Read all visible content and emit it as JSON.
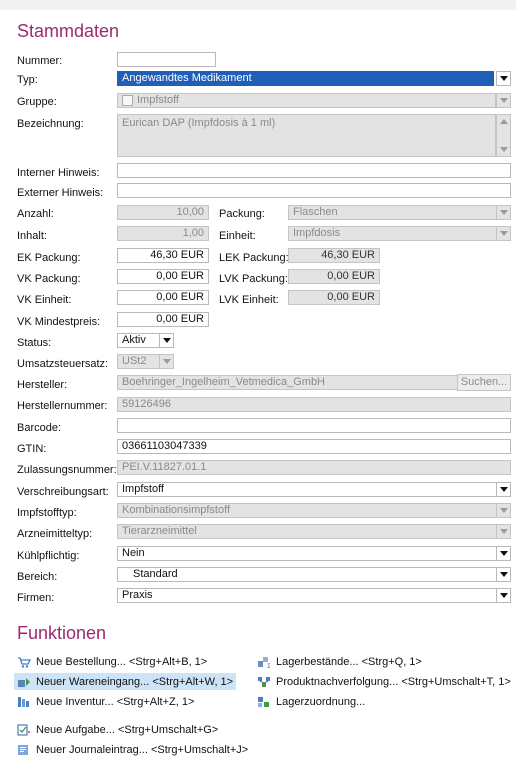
{
  "stammdaten": {
    "title": "Stammdaten",
    "nummer": {
      "label": "Nummer:",
      "value": ""
    },
    "typ": {
      "label": "Typ:",
      "value": "Angewandtes Medikament"
    },
    "gruppe": {
      "label": "Gruppe:",
      "value": "Impfstoff"
    },
    "bezeichnung": {
      "label": "Bezeichnung:",
      "value": "Eurican DAP (Impfdosis à 1 ml)"
    },
    "interner_hinweis": {
      "label": "Interner Hinweis:",
      "value": ""
    },
    "externer_hinweis": {
      "label": "Externer Hinweis:",
      "value": ""
    },
    "anzahl": {
      "label": "Anzahl:",
      "value": "10,00"
    },
    "packung": {
      "label": "Packung:",
      "value": "Flaschen"
    },
    "inhalt": {
      "label": "Inhalt:",
      "value": "1,00"
    },
    "einheit": {
      "label": "Einheit:",
      "value": "Impfdosis"
    },
    "ek_packung": {
      "label": "EK Packung:",
      "value": "46,30 EUR"
    },
    "lek_packung": {
      "label": "LEK Packung:",
      "value": "46,30 EUR"
    },
    "vk_packung": {
      "label": "VK Packung:",
      "value": "0,00 EUR"
    },
    "lvk_packung": {
      "label": "LVK Packung:",
      "value": "0,00 EUR"
    },
    "vk_einheit": {
      "label": "VK Einheit:",
      "value": "0,00 EUR"
    },
    "lvk_einheit": {
      "label": "LVK Einheit:",
      "value": "0,00 EUR"
    },
    "vk_mindestpreis": {
      "label": "VK Mindestpreis:",
      "value": "0,00 EUR"
    },
    "status": {
      "label": "Status:",
      "value": "Aktiv"
    },
    "umsatzsteuersatz": {
      "label": "Umsatzsteuersatz:",
      "value": "USt2"
    },
    "hersteller": {
      "label": "Hersteller:",
      "value": "Boehringer_Ingelheim_Vetmedica_GmbH",
      "button": "Suchen..."
    },
    "herstellernummer": {
      "label": "Herstellernummer:",
      "value": "59126496"
    },
    "barcode": {
      "label": "Barcode:",
      "value": ""
    },
    "gtin": {
      "label": "GTIN:",
      "value": "03661103047339"
    },
    "zulassungsnummer": {
      "label": "Zulassungsnummer:",
      "value": "PEI.V.11827.01.1"
    },
    "verschreibungsart": {
      "label": "Verschreibungsart:",
      "value": "Impfstoff"
    },
    "impfstofftyp": {
      "label": "Impfstofftyp:",
      "value": "Kombinationsimpfstoff"
    },
    "arzneimitteltyp": {
      "label": "Arzneimitteltyp:",
      "value": "Tierarzneimittel"
    },
    "kuehlpflichtig": {
      "label": "Kühlpflichtig:",
      "value": "Nein"
    },
    "bereich": {
      "label": "Bereich:",
      "value": "Standard"
    },
    "firmen": {
      "label": "Firmen:",
      "value": "Praxis"
    }
  },
  "funktionen": {
    "title": "Funktionen",
    "items": [
      {
        "label": "Neue Bestellung... <Strg+Alt+B, 1>",
        "icon": "cart-icon"
      },
      {
        "label": "Lagerbestände... <Strg+Q, 1>",
        "icon": "stock-icon"
      },
      {
        "label": "Neuer Wareneingang... <Strg+Alt+W, 1>",
        "icon": "goods-receipt-icon"
      },
      {
        "label": "Produktnachverfolgung... <Strg+Umschalt+T, 1>",
        "icon": "tracking-icon"
      },
      {
        "label": "Neue Inventur... <Strg+Alt+Z, 1>",
        "icon": "inventory-icon"
      },
      {
        "label": "Lagerzuordnung...",
        "icon": "storage-assignment-icon"
      },
      {
        "label": "Neue Aufgabe... <Strg+Umschalt+G>",
        "icon": "task-icon"
      },
      {
        "label": "Neuer Journaleintrag... <Strg+Umschalt+J>",
        "icon": "journal-icon"
      }
    ]
  },
  "colors": {
    "accent": "#9b2a6e",
    "selection": "#1f5fb8",
    "highlight": "#cde3f7"
  }
}
